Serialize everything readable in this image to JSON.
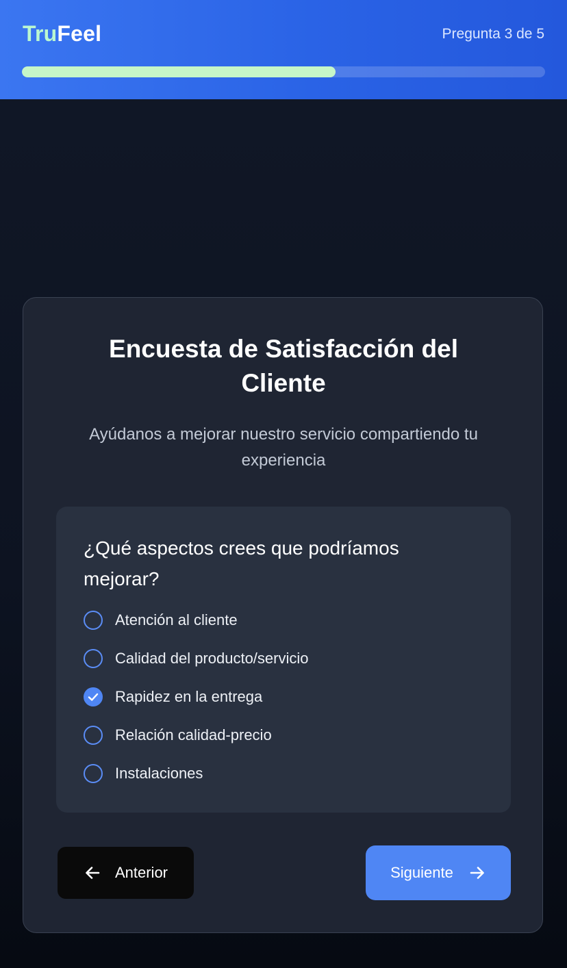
{
  "header": {
    "logo_part1": "Tru",
    "logo_part2": "Feel",
    "progress_label": "Pregunta 3 de 5",
    "progress_fraction": 0.6
  },
  "survey": {
    "title": "Encuesta de Satisfacción del Cliente",
    "subtitle": "Ayúdanos a mejorar nuestro servicio compartiendo tu experiencia",
    "question": "¿Qué aspectos crees que podríamos mejorar?",
    "options": [
      {
        "label": "Atención al cliente",
        "checked": false
      },
      {
        "label": "Calidad del producto/servicio",
        "checked": false
      },
      {
        "label": "Rapidez en la entrega",
        "checked": true
      },
      {
        "label": "Relación calidad-precio",
        "checked": false
      },
      {
        "label": "Instalaciones",
        "checked": false
      }
    ]
  },
  "navigation": {
    "prev_label": "Anterior",
    "prev_icon": "arrow-left-icon",
    "next_label": "Siguiente",
    "next_icon": "arrow-right-icon"
  },
  "colors": {
    "accent": "#4f86f4",
    "progress_fill": "#c6f6c8",
    "logo_highlight": "#bbf7d0"
  }
}
